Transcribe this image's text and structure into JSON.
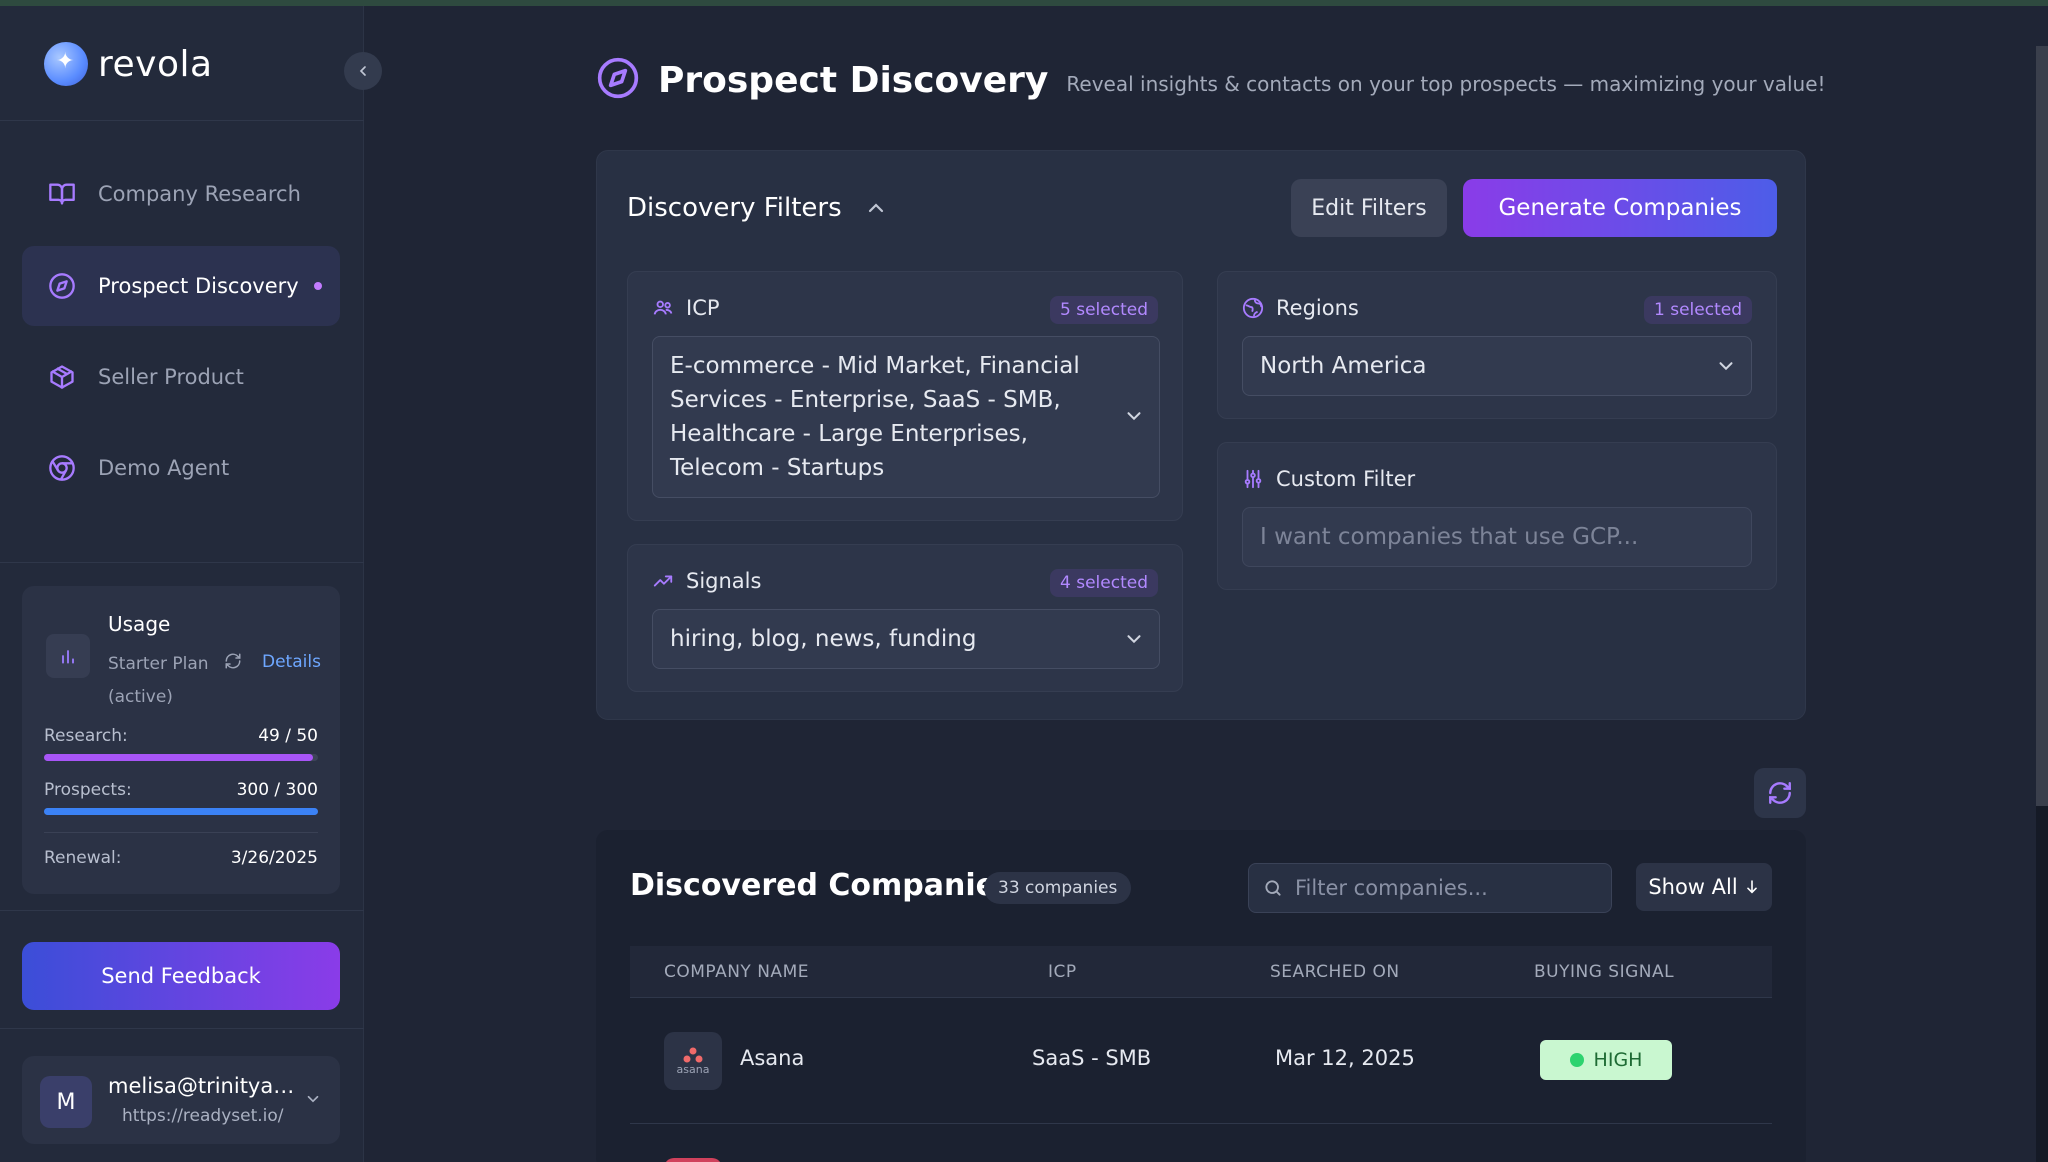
{
  "app": {
    "name": "revola"
  },
  "sidebar": {
    "items": [
      {
        "label": "Company Research",
        "icon": "book-open-icon"
      },
      {
        "label": "Prospect Discovery",
        "icon": "compass-icon",
        "active": true
      },
      {
        "label": "Seller Product",
        "icon": "box-icon"
      },
      {
        "label": "Demo Agent",
        "icon": "chrome-icon"
      }
    ]
  },
  "usage": {
    "title": "Usage",
    "plan": "Starter Plan (active)",
    "details_label": "Details",
    "research_label": "Research:",
    "research_value": "49 / 50",
    "research_used": 49,
    "research_total": 50,
    "prospects_label": "Prospects:",
    "prospects_value": "300 / 300",
    "prospects_used": 300,
    "prospects_total": 300,
    "renewal_label": "Renewal:",
    "renewal_value": "3/26/2025"
  },
  "feedback": {
    "label": "Send Feedback"
  },
  "user": {
    "initial": "M",
    "email": "melisa@trinityagi...",
    "site": "https://readyset.io/"
  },
  "header": {
    "title": "Prospect Discovery",
    "subtitle": "Reveal insights & contacts on your top prospects — maximizing your value!"
  },
  "filters": {
    "title": "Discovery Filters",
    "edit_label": "Edit Filters",
    "generate_label": "Generate Companies",
    "icp": {
      "label": "ICP",
      "badge": "5 selected",
      "value": "E-commerce - Mid Market, Financial Services - Enterprise, SaaS - SMB, Healthcare - Large Enterprises, Telecom - Startups"
    },
    "signals": {
      "label": "Signals",
      "badge": "4 selected",
      "value": "hiring, blog, news, funding"
    },
    "regions": {
      "label": "Regions",
      "badge": "1 selected",
      "value": "North America"
    },
    "custom": {
      "label": "Custom Filter",
      "placeholder": "I want companies that use GCP..."
    }
  },
  "companies": {
    "title": "Discovered Companies",
    "count": "33 companies",
    "search_placeholder": "Filter companies...",
    "show_all_label": "Show All",
    "columns": [
      "COMPANY NAME",
      "ICP",
      "SEARCHED ON",
      "BUYING SIGNAL"
    ],
    "rows": [
      {
        "logo_text": "asana",
        "name": "Asana",
        "icp": "SaaS - SMB",
        "searched_on": "Mar 12, 2025",
        "signal": "HIGH"
      }
    ]
  },
  "colors": {
    "accent": "#8a3ce8",
    "research_bar": "#a855f7",
    "prospects_bar": "#3b82f6",
    "signal_high": "#2dd36f"
  }
}
